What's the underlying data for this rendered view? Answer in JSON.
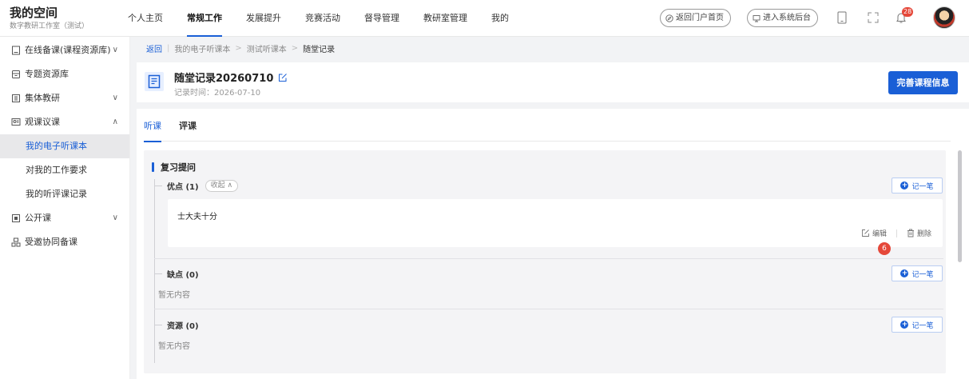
{
  "brand": {
    "title": "我的空间",
    "subtitle": "数字教研工作室（测试）"
  },
  "nav": [
    {
      "label": "个人主页",
      "active": false
    },
    {
      "label": "常规工作",
      "active": true
    },
    {
      "label": "发展提升",
      "active": false
    },
    {
      "label": "竞赛活动",
      "active": false
    },
    {
      "label": "督导管理",
      "active": false
    },
    {
      "label": "教研室管理",
      "active": false
    },
    {
      "label": "我的",
      "active": false
    }
  ],
  "topbar": {
    "portal_label": "返回门户首页",
    "backend_label": "进入系统后台",
    "bell_count": "28"
  },
  "sidebar": {
    "items": [
      {
        "label": "在线备课(课程资源库)",
        "chevron": "∨"
      },
      {
        "label": "专题资源库",
        "chevron": ""
      },
      {
        "label": "集体教研",
        "chevron": "∨"
      },
      {
        "label": "观课议课",
        "chevron": "∧"
      }
    ],
    "subitems": [
      "我的电子听课本",
      "对我的工作要求",
      "我的听评课记录"
    ],
    "items2": [
      {
        "label": "公开课",
        "chevron": "∨"
      },
      {
        "label": "受邀协同备课",
        "chevron": ""
      }
    ]
  },
  "breadcrumb": {
    "back": "返回",
    "crumb1": "我的电子听课本",
    "crumb2": "测试听课本",
    "current": "随堂记录",
    "sep": ">"
  },
  "record": {
    "title": "随堂记录20260710",
    "time": "记录时间：2026-07-10",
    "complete_label": "完善课程信息"
  },
  "tabs": [
    {
      "label": "听课"
    },
    {
      "label": "评课"
    }
  ],
  "section": {
    "title": "复习提问",
    "note_label": "记一笔",
    "groups": [
      {
        "head": "优点 (1)",
        "fold_label": "收起 ∧",
        "note_text": "士大夫十分",
        "edit_label": "编辑",
        "delete_label": "删除",
        "marker": "6"
      },
      {
        "head": "缺点 (0)",
        "empty": "暂无内容"
      },
      {
        "head": "资源 (0)",
        "empty": "暂无内容"
      }
    ]
  },
  "colors": {
    "accent": "#1a5fd6",
    "badge": "#e5483a"
  }
}
